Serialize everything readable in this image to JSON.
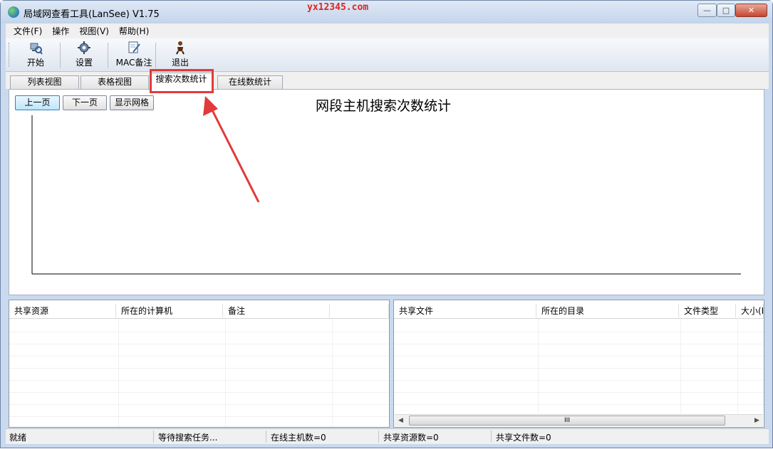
{
  "window": {
    "title": "局域网查看工具(LanSee) V1.75",
    "watermark": "yx12345.com",
    "controls": {
      "minimize": "—",
      "maximize": "□",
      "close": "✕"
    }
  },
  "menu": [
    "文件(F)",
    "操作",
    "视图(V)",
    "帮助(H)"
  ],
  "toolbar": {
    "start": "开始",
    "settings": "设置",
    "mac_note": "MAC备注",
    "exit": "退出"
  },
  "tabs": [
    {
      "label": "列表视图",
      "active": false
    },
    {
      "label": "表格视图",
      "active": false
    },
    {
      "label": "搜索次数统计",
      "active": true
    },
    {
      "label": "在线数统计",
      "active": false
    }
  ],
  "chart_panel": {
    "prev_page": "上一页",
    "next_page": "下一页",
    "show_grid": "显示网格",
    "title": "网段主机搜索次数统计"
  },
  "chart_data": {
    "type": "bar",
    "title": "网段主机搜索次数统计",
    "categories": [],
    "values": [],
    "grid": false
  },
  "shares_table": {
    "columns": [
      "共享资源",
      "所在的计算机",
      "备注",
      ""
    ],
    "rows": []
  },
  "files_table": {
    "columns": [
      "共享文件",
      "所在的目录",
      "文件类型",
      "大小(K"
    ],
    "rows": []
  },
  "status": {
    "ready": "就绪",
    "task": "等待搜索任务...",
    "online_hosts": "在线主机数=0",
    "shared_resources": "共享资源数=0",
    "shared_files": "共享文件数=0"
  },
  "scroll": {
    "left": "◀",
    "right": "▶",
    "grip": "III"
  },
  "colors": {
    "annotation": "#e23a3a",
    "watermark": "#e2221f",
    "chrome": "#c9d9ee"
  }
}
